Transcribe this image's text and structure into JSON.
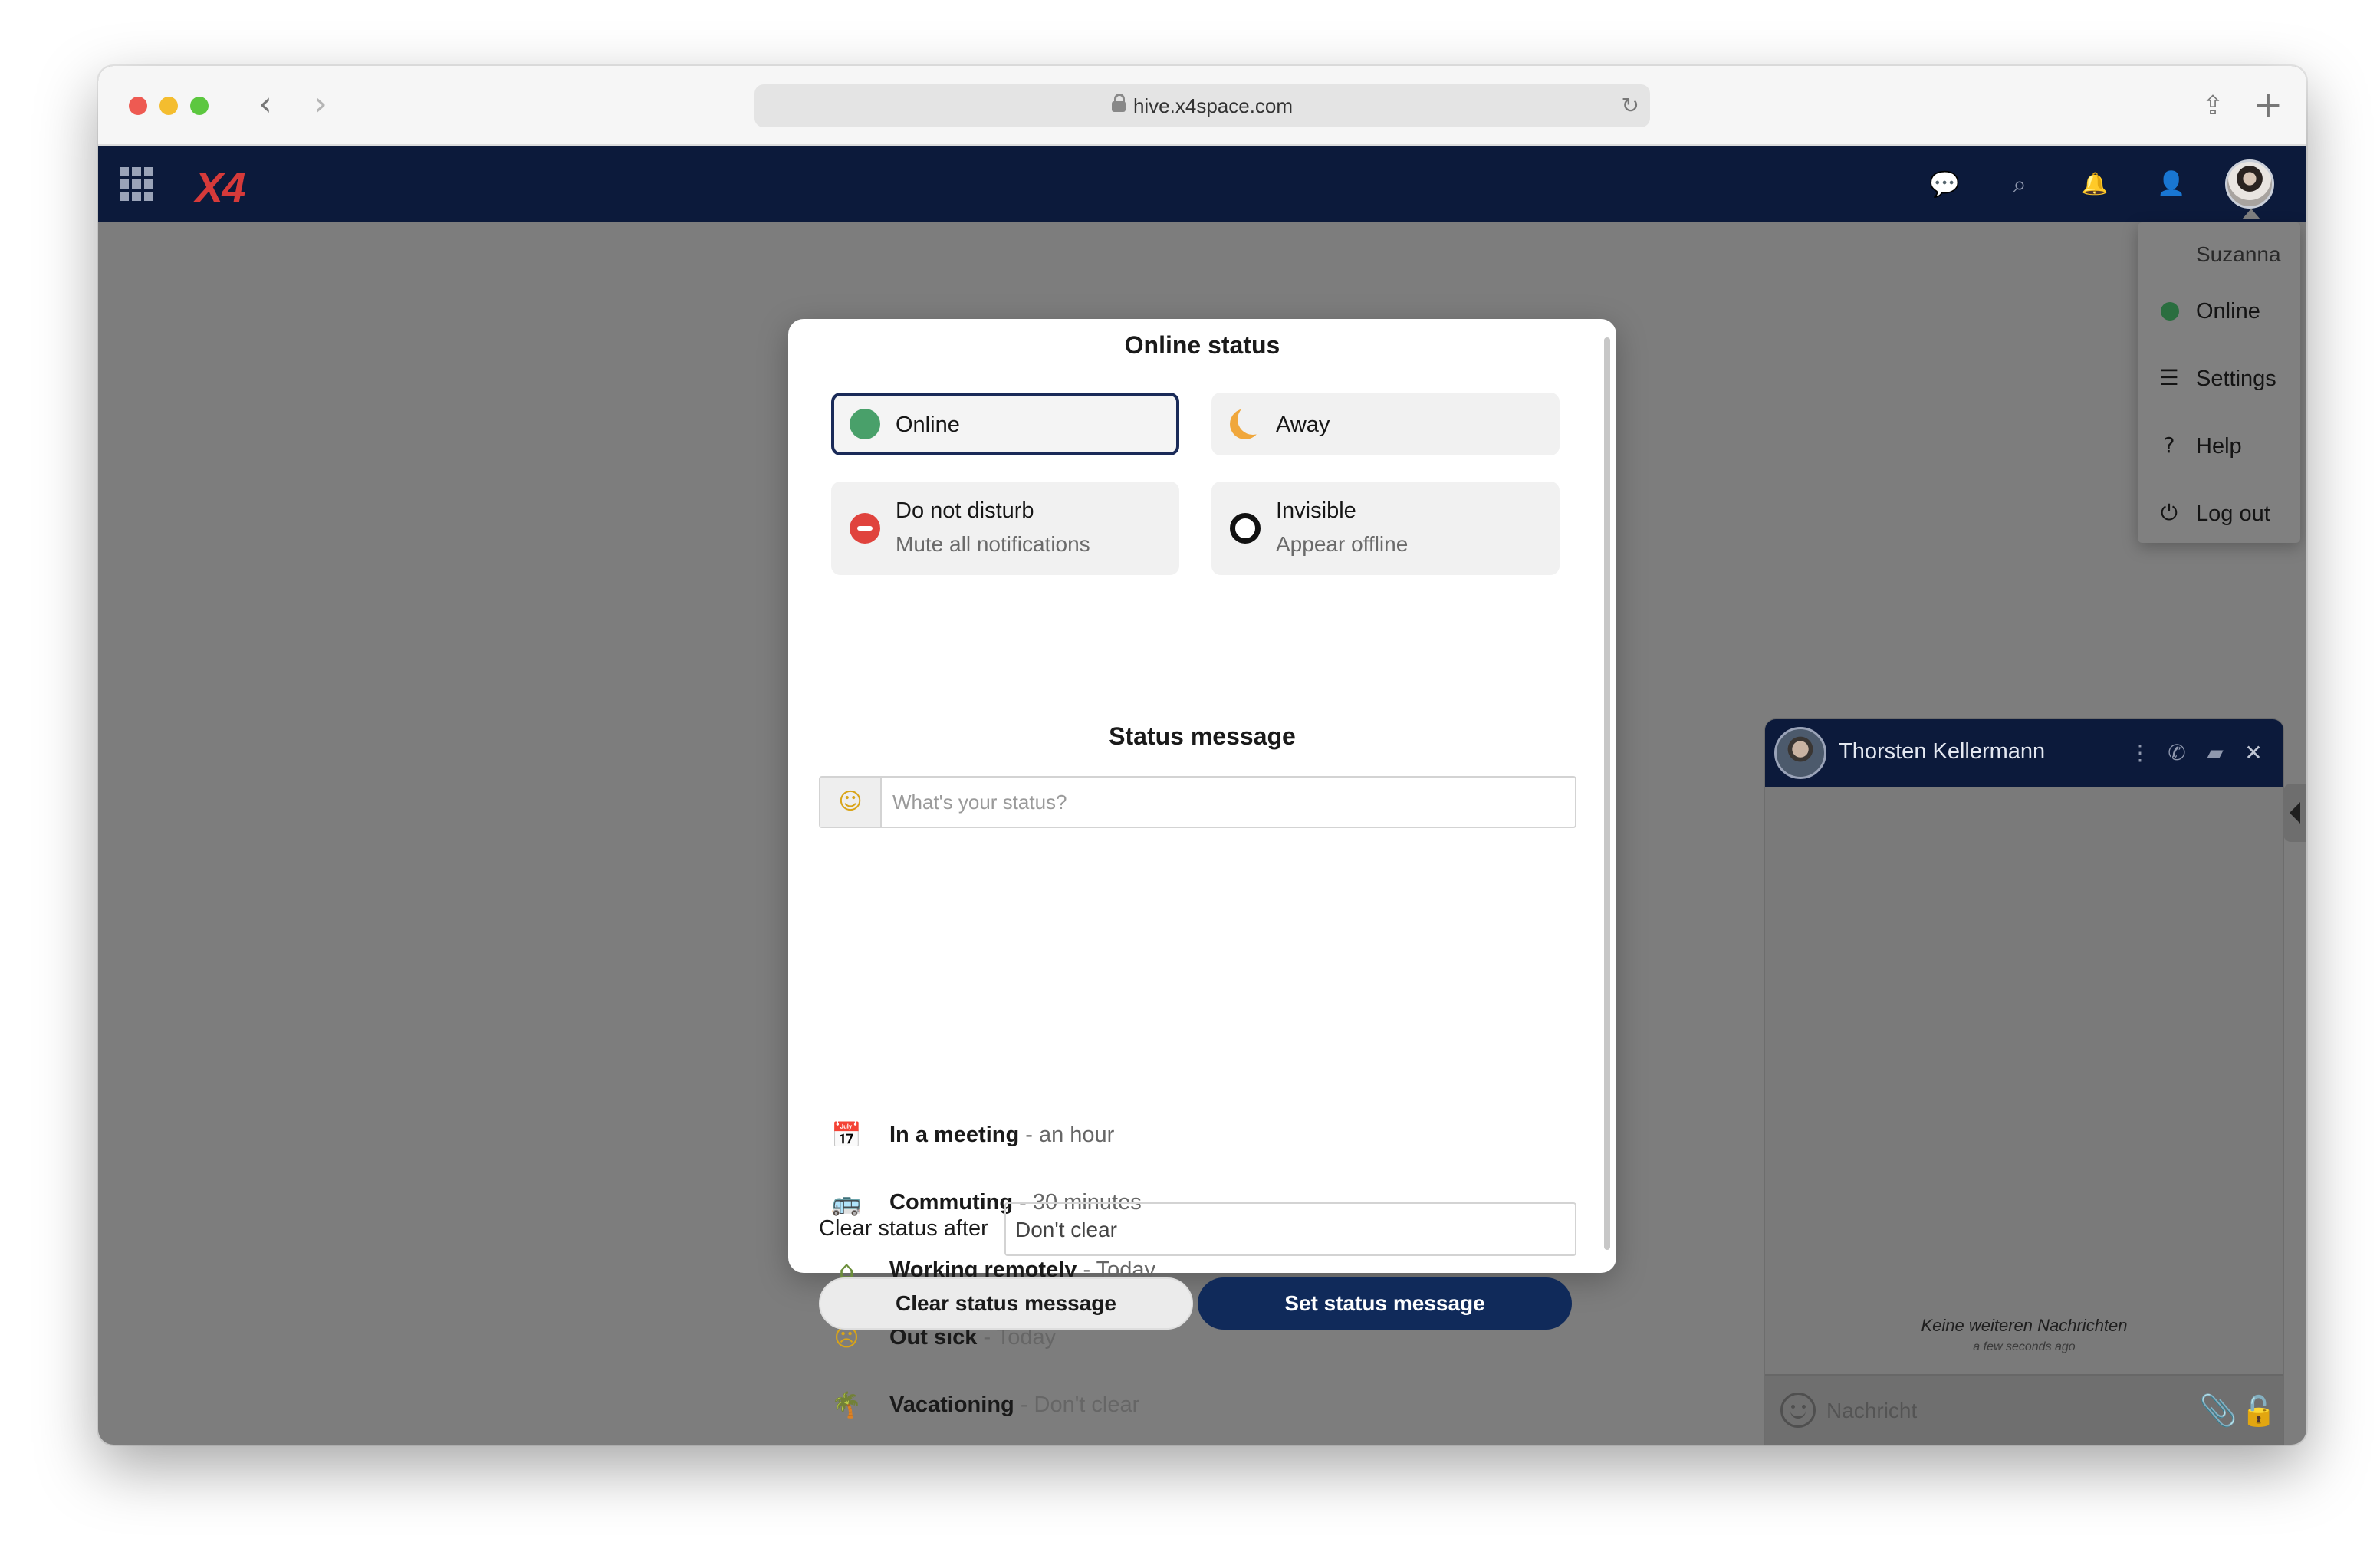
{
  "browser": {
    "url": "hive.x4space.com",
    "back_icon": "chevron-left-icon",
    "forward_icon": "chevron-right-icon",
    "reload_icon": "reload-icon",
    "share_icon": "share-icon",
    "new_tab_icon": "plus-icon"
  },
  "app": {
    "logo_text": "X4",
    "logo_color": "#d63a3a",
    "header_bg": "#0c1a3b",
    "header_icons": [
      "chat-icon",
      "search-icon",
      "bell-icon",
      "contacts-icon",
      "avatar"
    ]
  },
  "user_menu": {
    "name": "Suzanna",
    "items": [
      {
        "label": "Online",
        "icon": "online-status-dot-icon",
        "color": "#2a6e3f"
      },
      {
        "label": "Settings",
        "icon": "settings-list-icon"
      },
      {
        "label": "Help",
        "icon": "help-icon"
      },
      {
        "label": "Log out",
        "icon": "power-icon"
      }
    ]
  },
  "dialog": {
    "title": "Online status",
    "statuses": [
      {
        "label": "Online",
        "description": "",
        "selected": true,
        "color": "#49a06a",
        "icon": "online-dot-icon"
      },
      {
        "label": "Away",
        "description": "",
        "selected": false,
        "color": "#f0a73c",
        "icon": "moon-icon"
      },
      {
        "label": "Do not disturb",
        "description": "Mute all notifications",
        "selected": false,
        "color": "#e0433d",
        "icon": "do-not-disturb-icon"
      },
      {
        "label": "Invisible",
        "description": "Appear offline",
        "selected": false,
        "color": "#111111",
        "icon": "invisible-ring-icon"
      }
    ],
    "message_title": "Status message",
    "message_placeholder": "What's your status?",
    "emoji_picker_icon": "smiley-emoji-icon",
    "presets": [
      {
        "emoji": "calendar-emoji-icon",
        "title": "In a meeting",
        "duration": "- an hour"
      },
      {
        "emoji": "bus-emoji-icon",
        "title": "Commuting",
        "duration": "- 30 minutes"
      },
      {
        "emoji": "house-emoji-icon",
        "title": "Working remotely",
        "duration": "- Today"
      },
      {
        "emoji": "sick-face-emoji-icon",
        "title": "Out sick",
        "duration": "- Today"
      },
      {
        "emoji": "palm-tree-emoji-icon",
        "title": "Vacationing",
        "duration": "- Don't clear"
      }
    ],
    "clear_after_label": "Clear status after",
    "clear_after_value": "Don't clear",
    "clear_button": "Clear status message",
    "set_button": "Set status message",
    "accent_color": "#102a5a"
  },
  "chat": {
    "contact_name": "Thorsten Kellermann",
    "empty_text": "Keine weiteren Nachrichten",
    "timestamp": "a few seconds ago",
    "input_placeholder": "Nachricht",
    "icons": [
      "more-vertical-icon",
      "call-off-icon",
      "video-off-icon",
      "close-icon",
      "smiley-icon",
      "paperclip-icon",
      "lock-open-icon"
    ]
  }
}
